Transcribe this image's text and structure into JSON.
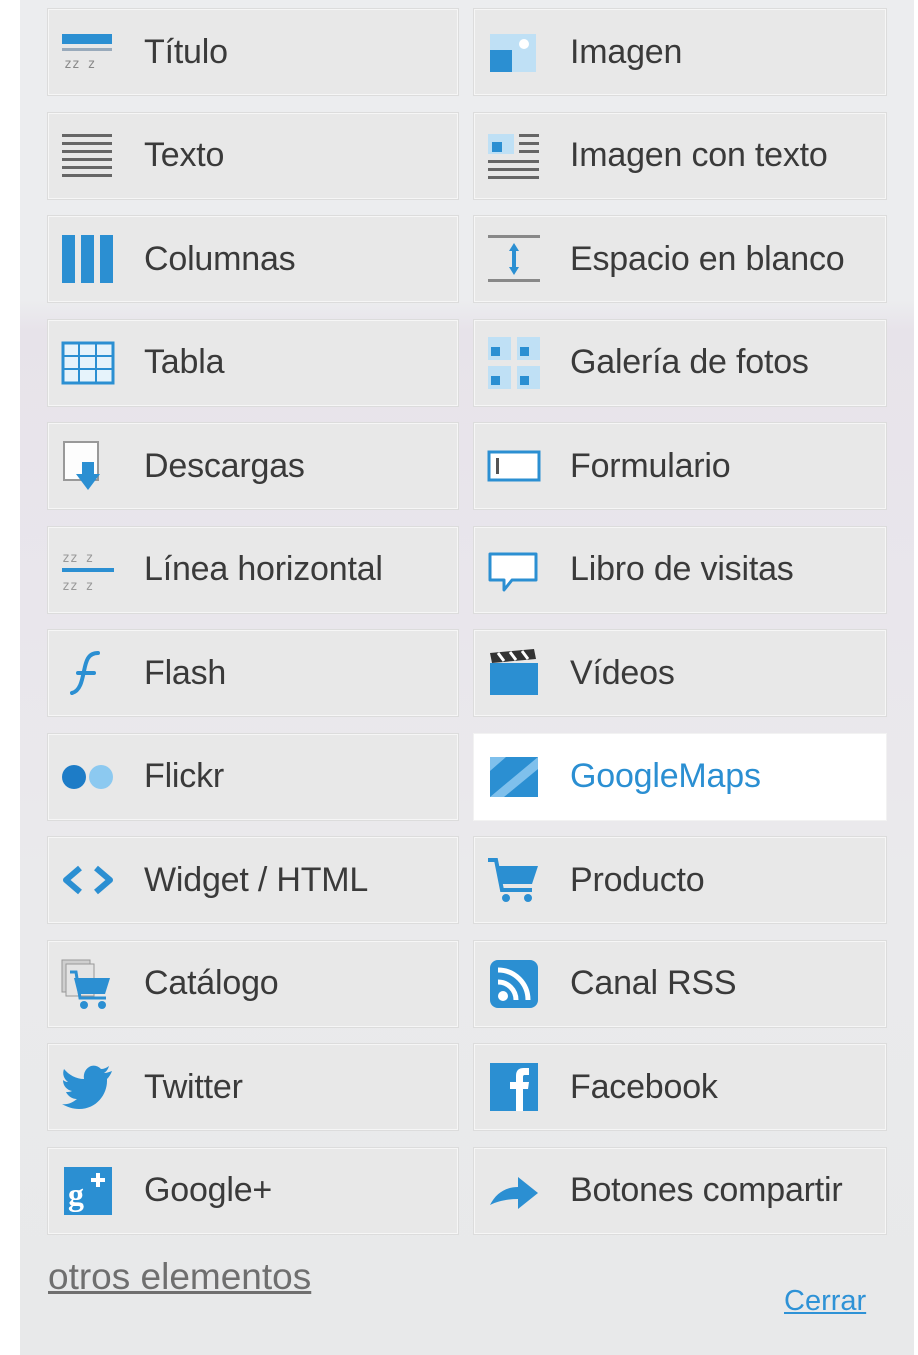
{
  "elements": [
    {
      "label": "Título",
      "icon": "title-icon"
    },
    {
      "label": "Imagen",
      "icon": "image-icon"
    },
    {
      "label": "Texto",
      "icon": "text-icon"
    },
    {
      "label": "Imagen con texto",
      "icon": "image-with-text-icon"
    },
    {
      "label": "Columnas",
      "icon": "columns-icon"
    },
    {
      "label": "Espacio en blanco",
      "icon": "spacer-icon"
    },
    {
      "label": "Tabla",
      "icon": "table-icon"
    },
    {
      "label": "Galería de fotos",
      "icon": "photo-gallery-icon"
    },
    {
      "label": "Descargas",
      "icon": "download-icon"
    },
    {
      "label": "Formulario",
      "icon": "form-icon"
    },
    {
      "label": "Línea horizontal",
      "icon": "horizontal-line-icon"
    },
    {
      "label": "Libro de visitas",
      "icon": "guestbook-icon"
    },
    {
      "label": "Flash",
      "icon": "flash-icon"
    },
    {
      "label": "Vídeos",
      "icon": "video-icon"
    },
    {
      "label": "Flickr",
      "icon": "flickr-icon"
    },
    {
      "label": "GoogleMaps",
      "icon": "googlemaps-icon",
      "active": true
    },
    {
      "label": "Widget / HTML",
      "icon": "widget-html-icon"
    },
    {
      "label": "Producto",
      "icon": "shopping-cart-icon"
    },
    {
      "label": "Catálogo",
      "icon": "catalog-icon"
    },
    {
      "label": "Canal RSS",
      "icon": "rss-icon"
    },
    {
      "label": "Twitter",
      "icon": "twitter-icon"
    },
    {
      "label": "Facebook",
      "icon": "facebook-icon"
    },
    {
      "label": "Google+",
      "icon": "google-plus-icon"
    },
    {
      "label": "Botones compartir",
      "icon": "share-buttons-icon"
    }
  ],
  "footer": {
    "more_label": "otros elementos",
    "close_label": "Cerrar"
  },
  "colors": {
    "accent": "#2b8fd2",
    "tile_bg": "#e8e8e8",
    "text": "#3a3a3a"
  }
}
